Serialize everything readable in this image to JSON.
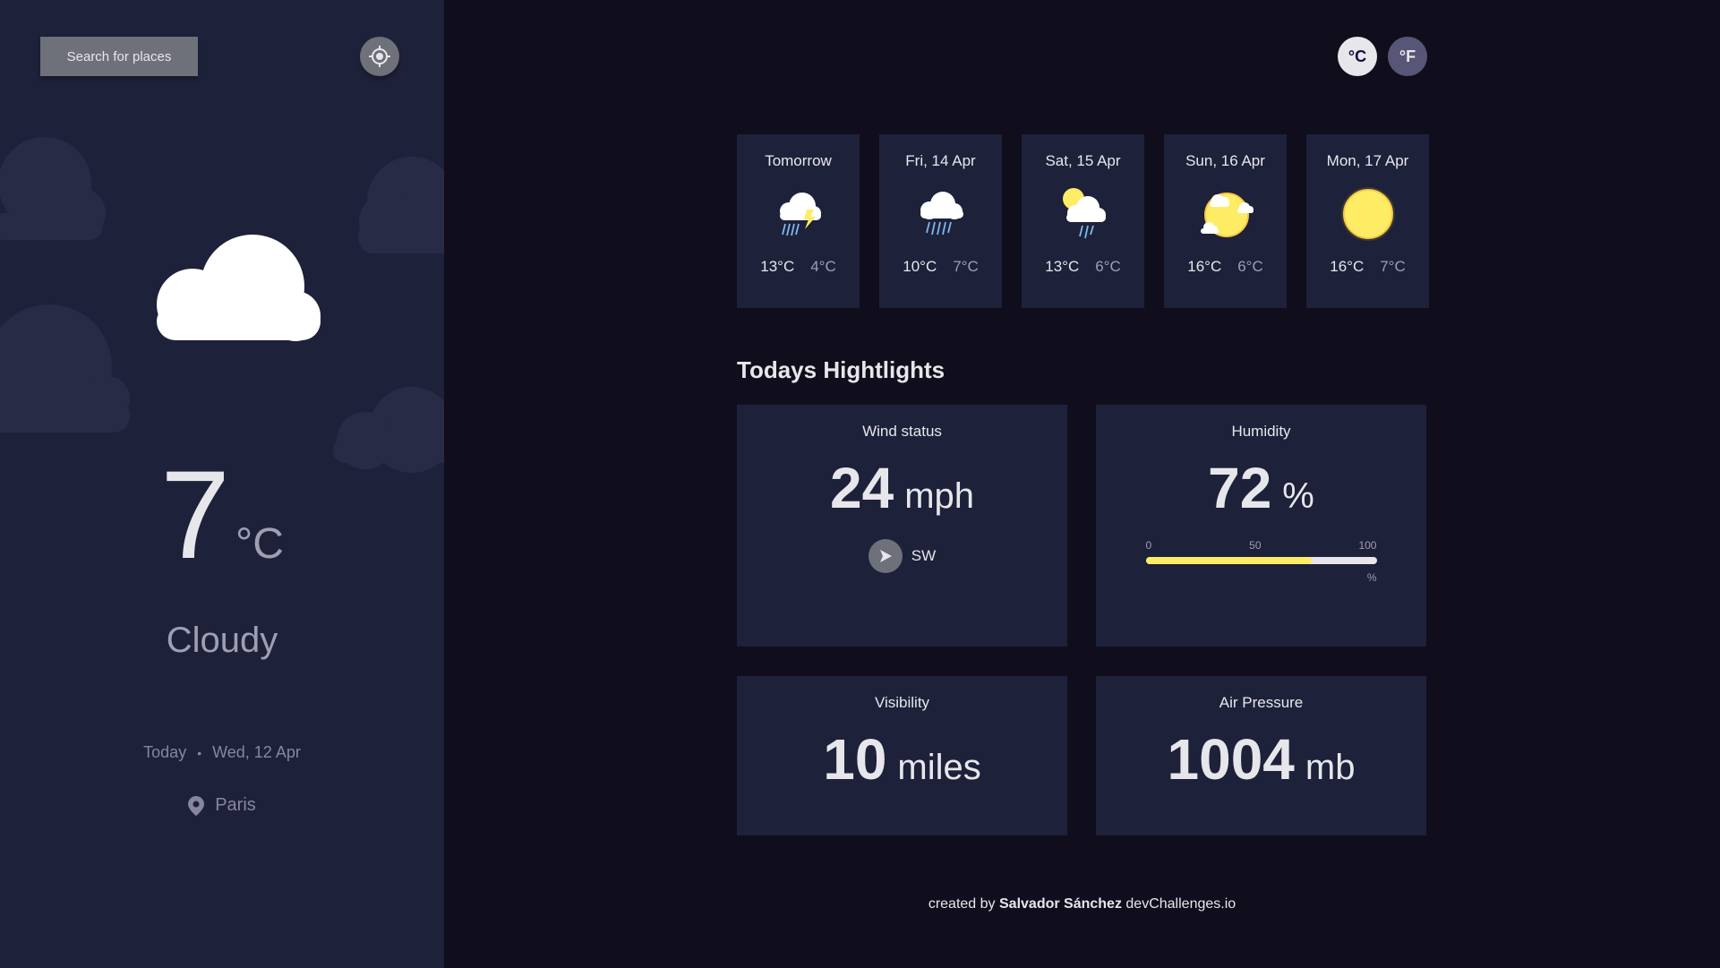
{
  "sidebar": {
    "search_label": "Search for places",
    "current": {
      "temperature": "7",
      "unit": "°C",
      "condition": "Cloudy",
      "icon": "cloud-icon",
      "date_prefix": "Today",
      "separator": "•",
      "date": "Wed, 12 Apr",
      "location": "Paris"
    }
  },
  "units": {
    "celsius": "°C",
    "fahrenheit": "°F",
    "selected": "celsius"
  },
  "forecast": [
    {
      "day": "Tomorrow",
      "icon": "thunderstorm-icon",
      "max": "13°C",
      "min": "4°C"
    },
    {
      "day": "Fri, 14 Apr",
      "icon": "heavy-rain-icon",
      "max": "10°C",
      "min": "7°C"
    },
    {
      "day": "Sat, 15 Apr",
      "icon": "shower-icon",
      "max": "13°C",
      "min": "6°C"
    },
    {
      "day": "Sun, 16 Apr",
      "icon": "light-cloud-icon",
      "max": "16°C",
      "min": "6°C"
    },
    {
      "day": "Mon, 17 Apr",
      "icon": "clear-icon",
      "max": "16°C",
      "min": "7°C"
    }
  ],
  "highlights": {
    "title": "Todays Hightlights",
    "wind": {
      "title": "Wind status",
      "value": "24",
      "unit": "mph",
      "direction": "SW"
    },
    "humidity": {
      "title": "Humidity",
      "value": "72",
      "unit": "%",
      "scale_min": "0",
      "scale_mid": "50",
      "scale_max": "100",
      "scale_unit": "%",
      "percent": 72
    },
    "visibility": {
      "title": "Visibility",
      "value": "10",
      "unit": "miles"
    },
    "pressure": {
      "title": "Air Pressure",
      "value": "1004",
      "unit": "mb"
    }
  },
  "footer": {
    "prefix": "created by",
    "author": "Salvador Sánchez",
    "site": "devChallenges.io"
  },
  "colors": {
    "sidebar_bg": "#1e213a",
    "main_bg": "#100e1d",
    "card_bg": "#1e213a",
    "accent_yellow": "#ffec65",
    "button_gray": "#6e707a"
  }
}
